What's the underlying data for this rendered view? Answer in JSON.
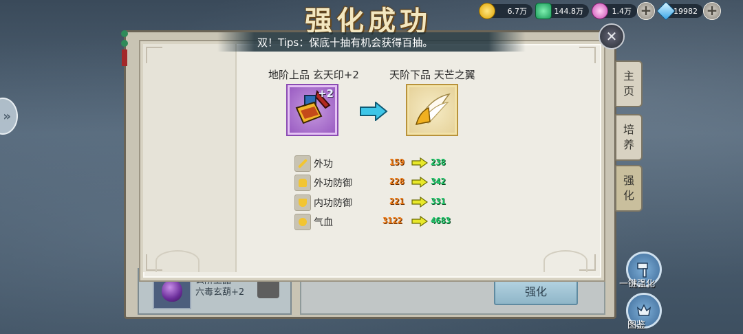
{
  "title": "强化成功",
  "tips": "双！Tips：保底十抽有机会获得百抽。",
  "currencies": [
    {
      "icon": "gold-coin-icon",
      "value": "6.7万"
    },
    {
      "icon": "jade-icon",
      "value": "144.8万"
    },
    {
      "icon": "pink-gem-icon",
      "value": "1.4万"
    },
    {
      "icon": "diamond-icon",
      "value": "19982"
    }
  ],
  "plus_symbol": "+",
  "close_symbol": "✕",
  "upgrade": {
    "from": {
      "name": "地阶上品 玄天印+2",
      "badge": "+2"
    },
    "to": {
      "name": "天阶下品 天芒之翼"
    }
  },
  "stats": [
    {
      "icon": "sword-icon",
      "label": "外功",
      "old": "159",
      "new": "238"
    },
    {
      "icon": "armor-icon",
      "label": "外功防御",
      "old": "228",
      "new": "342"
    },
    {
      "icon": "shield-icon",
      "label": "内功防御",
      "old": "221",
      "new": "331"
    },
    {
      "icon": "heart-shield-icon",
      "label": "气血",
      "old": "3122",
      "new": "4683"
    }
  ],
  "side_tabs": [
    {
      "label_a": "主",
      "label_b": "页"
    },
    {
      "label_a": "培",
      "label_b": "养"
    },
    {
      "label_a": "强",
      "label_b": "化"
    }
  ],
  "background": {
    "item_text_1": "玄阶上品",
    "item_text_2": "六毒玄葫+2",
    "enhance_button": "强化"
  },
  "right_buttons": [
    {
      "label": "一键强化"
    },
    {
      "label": "图鉴"
    }
  ],
  "left_arrow": "»",
  "colors": {
    "old_value": "#f07a12",
    "new_value": "#1ec86a",
    "arrow": "#3ec6e8"
  }
}
